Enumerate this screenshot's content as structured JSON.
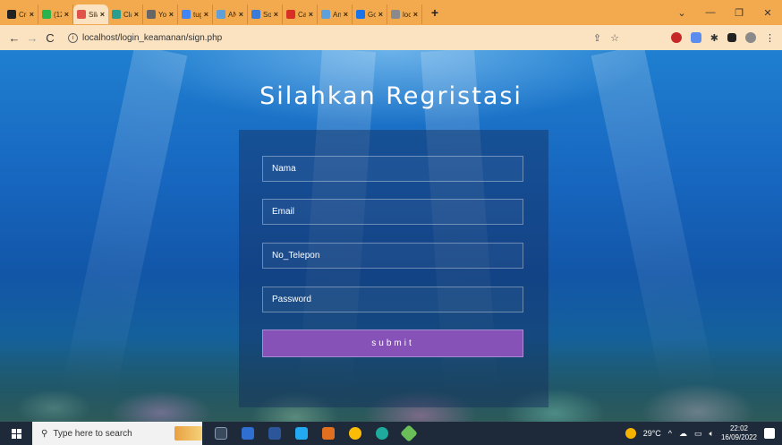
{
  "browser": {
    "tabs": [
      {
        "label": "Cre",
        "color": "#222222"
      },
      {
        "label": "(12",
        "color": "#2bb24c"
      },
      {
        "label": "Sila",
        "color": "#e0534a",
        "active": true
      },
      {
        "label": "Cla",
        "color": "#2a9d8f"
      },
      {
        "label": "You",
        "color": "#666666"
      },
      {
        "label": "tug",
        "color": "#4285f4"
      },
      {
        "label": "AN",
        "color": "#5fa0d8"
      },
      {
        "label": "Sof",
        "color": "#3a7bd5"
      },
      {
        "label": "Car",
        "color": "#d93025"
      },
      {
        "label": "An",
        "color": "#5fa0d8"
      },
      {
        "label": "Go",
        "color": "#1a73e8"
      },
      {
        "label": "loc",
        "color": "#8a8a8a"
      }
    ],
    "tab_close": "×",
    "new_tab": "+",
    "url": "localhost/login_keamanan/sign.php",
    "nav": {
      "back": "←",
      "forward": "→",
      "reload": "C"
    },
    "window_controls": {
      "chevron": "⌄",
      "minimize": "—",
      "restore": "❐",
      "close": "✕"
    }
  },
  "page": {
    "title": "Silahkan Regristasi",
    "fields": {
      "nama": {
        "placeholder": "Nama"
      },
      "email": {
        "placeholder": "Email"
      },
      "telepon": {
        "placeholder": "No_Telepon"
      },
      "password": {
        "placeholder": "Password"
      }
    },
    "submit_label": "submit"
  },
  "taskbar": {
    "search_placeholder": "Type here to search",
    "weather": "29°C",
    "time": "22:02",
    "date": "16/09/2022"
  },
  "colors": {
    "tab_strip": "#f3a94d",
    "address_bar": "#fbe3c2",
    "submit": "#8652b8",
    "taskbar": "#1e2a3a"
  }
}
